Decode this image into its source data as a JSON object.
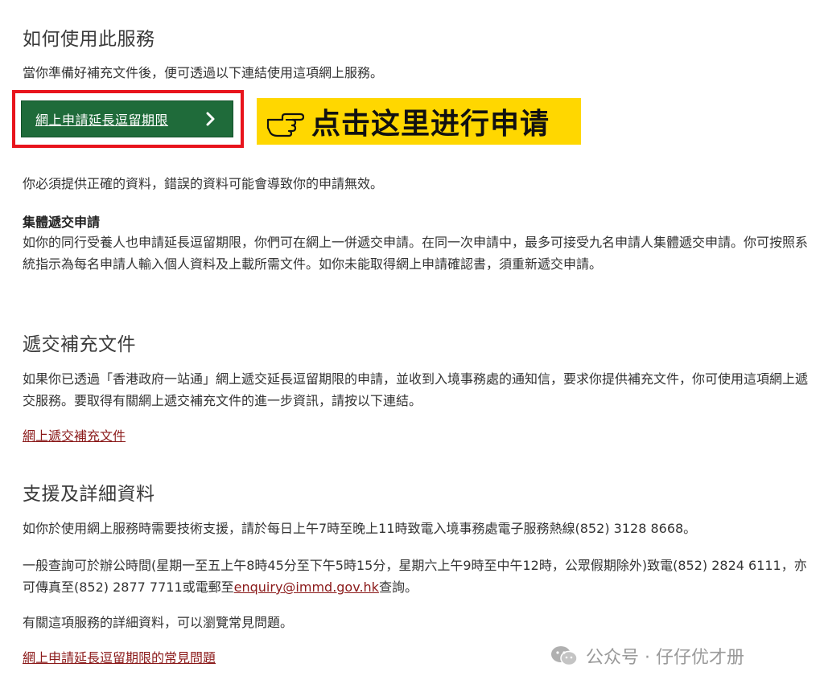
{
  "section_how": {
    "title": "如何使用此服務",
    "intro": "當你準備好補充文件後，便可透過以下連結使用這項網上服務。",
    "button_label": "網上申請延長逗留期限",
    "annotation": "点击这里进行申请",
    "accuracy_note": "你必須提供正確的資料，錯誤的資料可能會導致你的申請無效。",
    "group_title": "集體遞交申請",
    "group_text": "如你的同行受養人也申請延長逗留期限，你們可在網上一併遞交申請。在同一次申請中，最多可接受九名申請人集體遞交申請。你可按照系統指示為每名申請人輸入個人資料及上載所需文件。如你未能取得網上申請確認書，須重新遞交申請。"
  },
  "section_supp": {
    "title": "遞交補充文件",
    "text": "如果你已透過「香港政府一站通」網上遞交延長逗留期限的申請，並收到入境事務處的通知信，要求你提供補充文件，你可使用這項網上遞交服務。要取得有關網上遞交補充文件的進一步資訊，請按以下連結。",
    "link": "網上遞交補充文件"
  },
  "section_support": {
    "title": "支援及詳細資料",
    "tech": "如你於使用網上服務時需要技術支援，請於每日上午7時至晚上11時致電入境事務處電子服務熱線(852) 3128 8668。",
    "general_before": "一般查詢可於辦公時間(星期一至五上午8時45分至下午5時15分，星期六上午9時至中午12時，公眾假期除外)致電(852) 2824 6111，亦可傳真至(852) 2877 7711或電郵至",
    "email": "enquiry@immd.gov.hk",
    "general_after": "查詢。",
    "faq_intro": "有關這項服務的詳細資料，可以瀏覽常見問題。",
    "faq_link": "網上申請延長逗留期限的常見問題"
  },
  "watermark": "公众号 · 仔仔优才册",
  "icons": {
    "button": "chevron-right-icon",
    "annotation": "pointing-hand-icon",
    "watermark": "wechat-icon"
  },
  "colors": {
    "button_bg": "#1f6b3a",
    "highlight_frame": "#e8141c",
    "annotation_bg": "#ffd700",
    "link": "#8b1a1a"
  }
}
